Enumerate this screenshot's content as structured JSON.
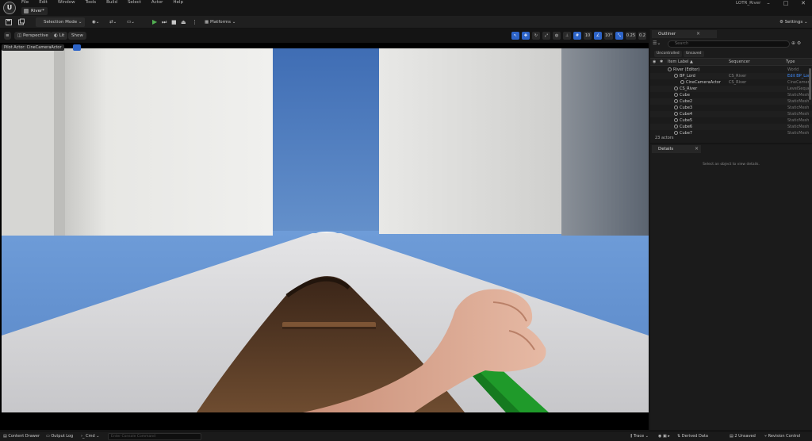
{
  "app": {
    "project_name": "LOTR_River",
    "level_tab": "River*",
    "menus": [
      "File",
      "Edit",
      "Window",
      "Tools",
      "Build",
      "Select",
      "Actor",
      "Help"
    ],
    "window_controls": [
      "–",
      "□",
      "✕"
    ]
  },
  "toolbar": {
    "selection_mode": "Selection Mode",
    "platforms": "Platforms",
    "settings": "Settings"
  },
  "viewport": {
    "perspective": "Perspective",
    "lit": "Lit",
    "show": "Show",
    "pilot_label": "Pilot Actor: CineCameraActor",
    "camera_speed": "0.25",
    "fov": "0.2"
  },
  "outliner": {
    "tab": "Outliner",
    "search_placeholder": "Search",
    "chips": [
      "Uncontrolled",
      "Unsaved"
    ],
    "columns": {
      "label": "Item Label ▲",
      "sequencer": "Sequencer",
      "type": "Type"
    },
    "rows": [
      {
        "label": "River (Editor)",
        "seq": "",
        "type": "World",
        "indent": 0
      },
      {
        "label": "BP_Lord",
        "seq": "CS_River",
        "type": "Edit BP_Lord",
        "indent": 1
      },
      {
        "label": "CineCameraActor",
        "seq": "CS_River",
        "type": "CineCameraActor",
        "indent": 2
      },
      {
        "label": "CS_River",
        "seq": "",
        "type": "LevelSequenceActor",
        "indent": 1
      },
      {
        "label": "Cube",
        "seq": "",
        "type": "StaticMeshActor",
        "indent": 1
      },
      {
        "label": "Cube2",
        "seq": "",
        "type": "StaticMeshActor",
        "indent": 1
      },
      {
        "label": "Cube3",
        "seq": "",
        "type": "StaticMeshActor",
        "indent": 1
      },
      {
        "label": "Cube4",
        "seq": "",
        "type": "StaticMeshActor",
        "indent": 1
      },
      {
        "label": "Cube5",
        "seq": "",
        "type": "StaticMeshActor",
        "indent": 1
      },
      {
        "label": "Cube6",
        "seq": "",
        "type": "StaticMeshActor",
        "indent": 1
      },
      {
        "label": "Cube7",
        "seq": "",
        "type": "StaticMeshActor",
        "indent": 1
      }
    ],
    "count": "23 actors"
  },
  "details": {
    "tab": "Details",
    "empty": "Select an object to view details."
  },
  "statusbar": {
    "content_drawer": "Content Drawer",
    "output_log": "Output Log",
    "cmd": "Cmd",
    "console_placeholder": "Enter Console Command",
    "trace": "Trace",
    "derived_data": "Derived Data",
    "unsaved": "2 Unsaved",
    "revision_control": "Revision Control"
  },
  "colors": {
    "accent": "#2d64c8",
    "play": "#52b052",
    "link": "#3f8cff"
  }
}
